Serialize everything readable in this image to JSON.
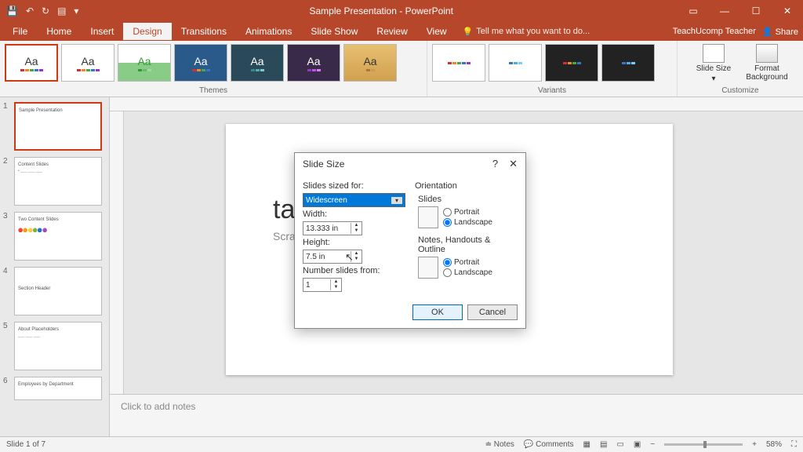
{
  "titlebar": {
    "title": "Sample Presentation - PowerPoint"
  },
  "ribbon": {
    "tabs": [
      "File",
      "Home",
      "Insert",
      "Design",
      "Transitions",
      "Animations",
      "Slide Show",
      "Review",
      "View"
    ],
    "active_tab": "Design",
    "tellme": "Tell me what you want to do...",
    "user": "TeachUcomp Teacher",
    "share": "Share",
    "groups": {
      "themes": "Themes",
      "variants": "Variants",
      "customize": "Customize"
    },
    "slide_size_label": "Slide Size",
    "format_bg_label": "Format Background"
  },
  "thumbs": {
    "slides": [
      {
        "n": "1",
        "title": "Sample Presentation",
        "sub": ""
      },
      {
        "n": "2",
        "title": "Content Slides",
        "sub": ""
      },
      {
        "n": "3",
        "title": "Two Content Slides",
        "sub": ""
      },
      {
        "n": "4",
        "title": "Section Header",
        "sub": ""
      },
      {
        "n": "5",
        "title": "About Placeholders",
        "sub": ""
      },
      {
        "n": "6",
        "title": "Employees by Department",
        "sub": ""
      }
    ]
  },
  "slide": {
    "title": "tation",
    "subtitle": "Scratch"
  },
  "notes": {
    "placeholder": "Click to add notes"
  },
  "status": {
    "left": "Slide 1 of 7",
    "notes": "Notes",
    "comments": "Comments",
    "zoom": "58%"
  },
  "dialog": {
    "title": "Slide Size",
    "sized_for_label": "Slides sized for:",
    "sized_for_value": "Widescreen",
    "width_label": "Width:",
    "width_value": "13.333 in",
    "height_label": "Height:",
    "height_value": "7.5 in",
    "number_label": "Number slides from:",
    "number_value": "1",
    "orientation_label": "Orientation",
    "slides_label": "Slides",
    "notes_label": "Notes, Handouts & Outline",
    "portrait": "Portrait",
    "landscape": "Landscape",
    "ok": "OK",
    "cancel": "Cancel"
  }
}
